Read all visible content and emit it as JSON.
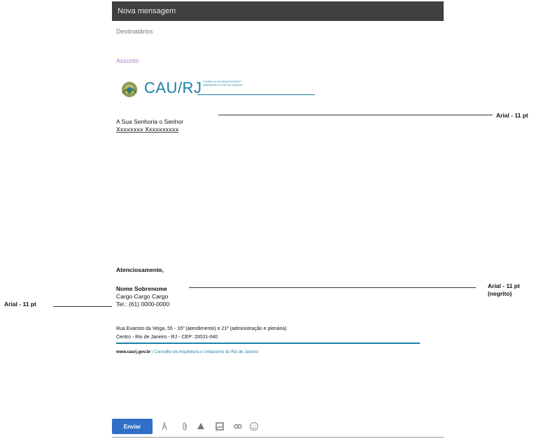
{
  "window": {
    "title": "Nova mensagem"
  },
  "fields": {
    "to_placeholder": "Destinatários",
    "subject_placeholder": "Assunto"
  },
  "logo": {
    "name": "CAU/RJ",
    "subtitle_1": "CONSELHO DE ARQUITETURA E",
    "subtitle_2": "URBANISMO DO RIO DE JANEIRO"
  },
  "letter": {
    "salutation": "A Sua Senhoria o Senhor",
    "recipient_name": "Xxxxxxxx Xxxxxxxxxx",
    "closing": "Atenciosamente,",
    "sender_name": "Nome Sobrenome",
    "sender_role": "Cargo Cargo Cargo",
    "sender_phone": "Tel.: (61) 0000-0000",
    "address_1": "Rua Evaristo da Veiga, 55 - 16º (atendimento) e 21º (administração e plenária)",
    "address_2": "Centro - Rio de Janeiro - RJ - CEP: 20031-040",
    "site": "www.caurj.gov.br",
    "site_desc": " | Conselho de Arquitetura e Urbanismo do Rio de Janeiro"
  },
  "annotations": {
    "right_top": "Arial - 11 pt",
    "right_sig_1": "Arial - 11 pt",
    "right_sig_2": "(negrito)",
    "left_sig": "Arial - 11 pt"
  },
  "toolbar": {
    "send_label": "Enviar",
    "icons": [
      "format-text-icon",
      "attach-icon",
      "drive-icon",
      "photo-icon",
      "link-icon",
      "emoji-icon"
    ]
  },
  "colors": {
    "header_bg": "#404040",
    "brand_blue": "#1c7fa6",
    "send_button": "#2f6fc7"
  }
}
